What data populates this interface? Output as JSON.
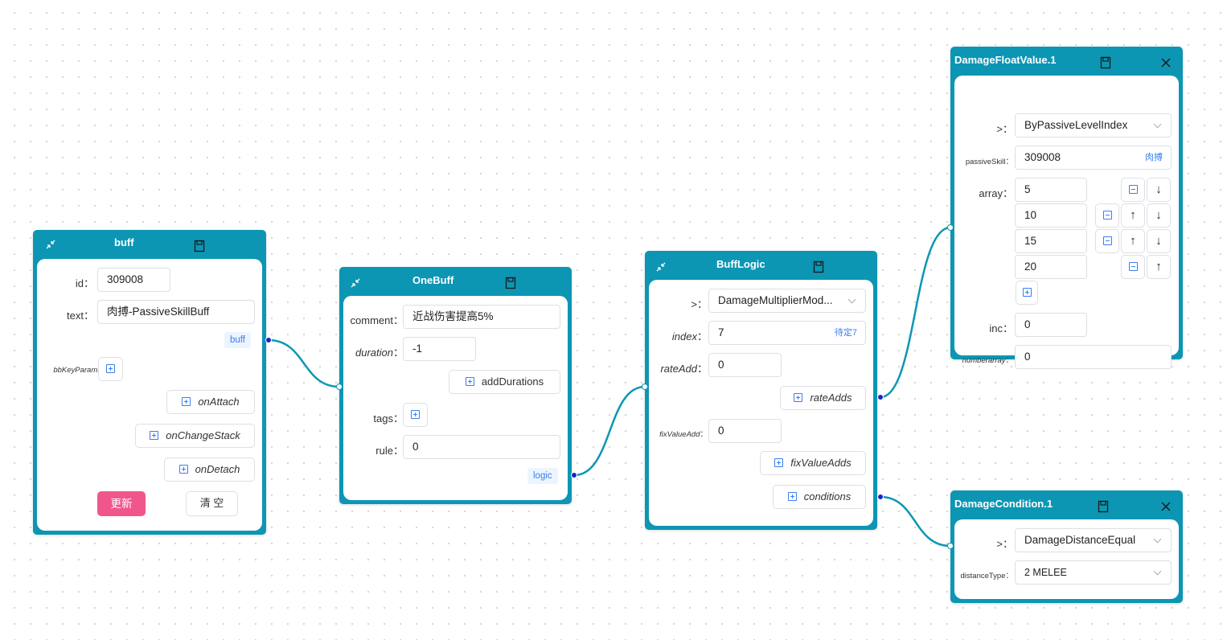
{
  "colors": {
    "node_header": "#0c96b4",
    "wire": "#0c96b4",
    "port_out": "#1525c9",
    "accent_blue": "#3a7ef0",
    "badge_bg": "#ecf5ff",
    "update_button": "#f0568c"
  },
  "icons": {
    "collapse": "collapse-icon",
    "save": "save-icon",
    "close": "close-icon",
    "add": "add-icon",
    "remove": "remove-icon",
    "move_up": "arrow-up-icon",
    "move_down": "arrow-down-icon",
    "dropdown": "chevron-down-icon"
  },
  "buff": {
    "title": "buff",
    "id_label": "id",
    "id_value": "309008",
    "text_label": "text",
    "text_value": "肉搏-PassiveSkillBuff",
    "port_badge": "buff",
    "bbKeyParams_label": "bbKeyParams",
    "onAttach": "onAttach",
    "onChangeStack": "onChangeStack",
    "onDetach": "onDetach",
    "update_label": "更新",
    "clear_label": "清 空"
  },
  "onebuff": {
    "title": "OneBuff",
    "comment_label": "comment",
    "comment_value": "近战伤害提高5%",
    "duration_label": "duration",
    "duration_value": "-1",
    "addDurations": "addDurations",
    "tags_label": "tags",
    "rule_label": "rule",
    "rule_value": "0",
    "port_badge": "logic"
  },
  "bufflogic": {
    "title": "BuffLogic",
    "type_label": ">",
    "type_value": "DamageMultiplierMod...",
    "index_label": "index",
    "index_value": "7",
    "index_suffix": "待定7",
    "rateAdd_label": "rateAdd",
    "rateAdd_value": "0",
    "rateAdds": "rateAdds",
    "fixValueAdd_label": "fixValueAdd",
    "fixValueAdd_value": "0",
    "fixValueAdds": "fixValueAdds",
    "conditions": "conditions"
  },
  "damagefloat": {
    "title": "DamageFloatValue.1",
    "type_label": ">",
    "type_value": "ByPassiveLevelIndex",
    "passiveSkill_label": "passiveSkill",
    "passiveSkill_value": "309008",
    "passiveSkill_suffix": "肉搏",
    "array_label": "array",
    "array": [
      "5",
      "10",
      "15",
      "20"
    ],
    "inc_label": "inc",
    "inc_value": "0",
    "numberarray_label": "numberarray",
    "numberarray_value": "0"
  },
  "damagecondition": {
    "title": "DamageCondition.1",
    "type_label": ">",
    "type_value": "DamageDistanceEqual",
    "distanceType_label": "distanceType",
    "distanceType_value": "2 MELEE"
  }
}
